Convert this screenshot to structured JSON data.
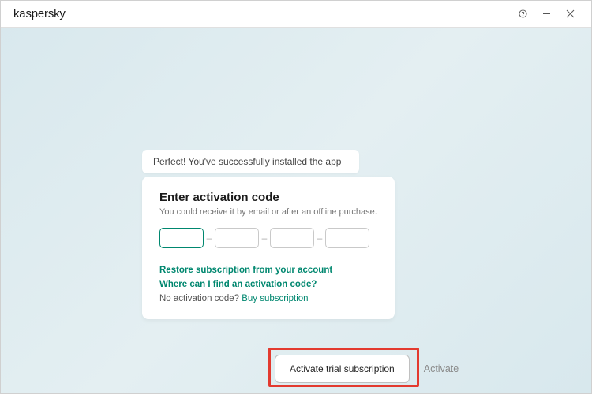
{
  "brand": "kaspersky",
  "toast": "Perfect! You've successfully installed the app",
  "card": {
    "heading": "Enter activation code",
    "subtitle": "You could receive it by email or after an offline purchase."
  },
  "links": {
    "restore": "Restore subscription from your account",
    "where": "Where can I find an activation code?",
    "nocode_prefix": "No activation code? ",
    "buy": "Buy subscription"
  },
  "buttons": {
    "trial": "Activate trial subscription",
    "activate": "Activate"
  },
  "segment_separator": "–"
}
